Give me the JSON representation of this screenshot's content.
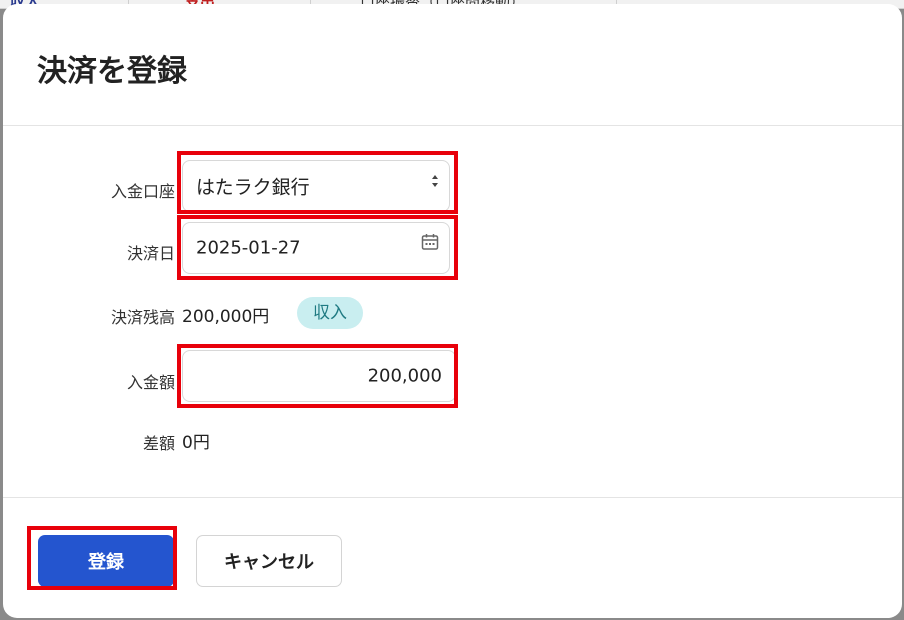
{
  "backdrop": {
    "item1": "収入",
    "item2": "支出",
    "item3": "口座振替（口座間移動）"
  },
  "modal": {
    "title": "決済を登録",
    "fields": {
      "account": {
        "label": "入金口座",
        "value": "はたラク銀行"
      },
      "date": {
        "label": "決済日",
        "value": "2025-01-27"
      },
      "balance": {
        "label": "決済残高",
        "value": "200,000円",
        "badge": "収入"
      },
      "amount": {
        "label": "入金額",
        "value": "200,000"
      },
      "difference": {
        "label": "差額",
        "value": "0円"
      }
    },
    "buttons": {
      "submit": "登録",
      "cancel": "キャンセル"
    }
  },
  "colors": {
    "primary": "#2455cf",
    "highlight": "#e8000a",
    "badge_bg": "#c9eef0",
    "badge_text": "#1f7a82"
  },
  "icons": {
    "select_arrow": "select-arrows-icon",
    "date_picker": "calendar-icon"
  }
}
